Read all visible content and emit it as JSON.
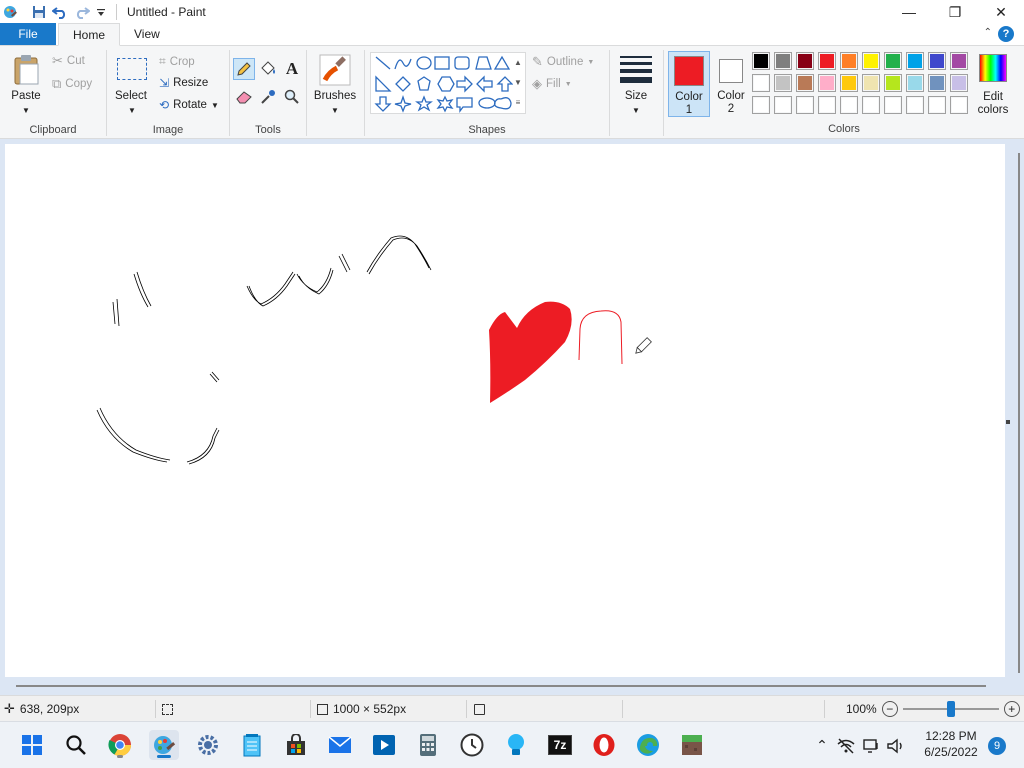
{
  "window": {
    "title": "Untitled - Paint",
    "controls": {
      "minimize": "—",
      "maximize": "❐",
      "close": "✕"
    }
  },
  "ribbon_tabs": [
    {
      "label": "File"
    },
    {
      "label": "Home"
    },
    {
      "label": "View"
    }
  ],
  "ribbon": {
    "clipboard": {
      "group_label": "Clipboard",
      "paste": "Paste",
      "cut": "Cut",
      "copy": "Copy"
    },
    "image": {
      "group_label": "Image",
      "select": "Select",
      "crop": "Crop",
      "resize": "Resize",
      "rotate": "Rotate"
    },
    "tools": {
      "group_label": "Tools",
      "text_glyph": "A"
    },
    "brushes": {
      "label": "Brushes"
    },
    "shapes": {
      "group_label": "Shapes",
      "outline": "Outline",
      "fill": "Fill"
    },
    "size": {
      "label": "Size"
    },
    "color1": {
      "label_line1": "Color",
      "label_line2": "1",
      "color": "#ed1c24"
    },
    "color2": {
      "label_line1": "Color",
      "label_line2": "2",
      "color": "#ffffff"
    },
    "colors": {
      "group_label": "Colors",
      "edit_line1": "Edit",
      "edit_line2": "colors",
      "palette_row1": [
        "#000000",
        "#7f7f7f",
        "#880015",
        "#ed1c24",
        "#ff7f27",
        "#fff200",
        "#22b14c",
        "#00a2e8",
        "#3f48cc",
        "#a349a4"
      ],
      "palette_row2": [
        "#ffffff",
        "#c3c3c3",
        "#b97a57",
        "#ffaec9",
        "#ffc90e",
        "#efe4b0",
        "#b5e61d",
        "#99d9ea",
        "#7092be",
        "#c8bfe7"
      ],
      "palette_row3": [
        "#ffffff",
        "#ffffff",
        "#ffffff",
        "#ffffff",
        "#ffffff",
        "#ffffff",
        "#ffffff",
        "#ffffff",
        "#ffffff",
        "#ffffff"
      ]
    }
  },
  "status": {
    "cursor_pos": "638, 209px",
    "canvas_size": "1000 × 552px",
    "zoom": "100%",
    "zoom_minus": "−",
    "zoom_plus": "+"
  },
  "taskbar": {
    "time": "12:28 PM",
    "date": "6/25/2022",
    "notification_count": "9",
    "sevenzip_label": "7z"
  }
}
